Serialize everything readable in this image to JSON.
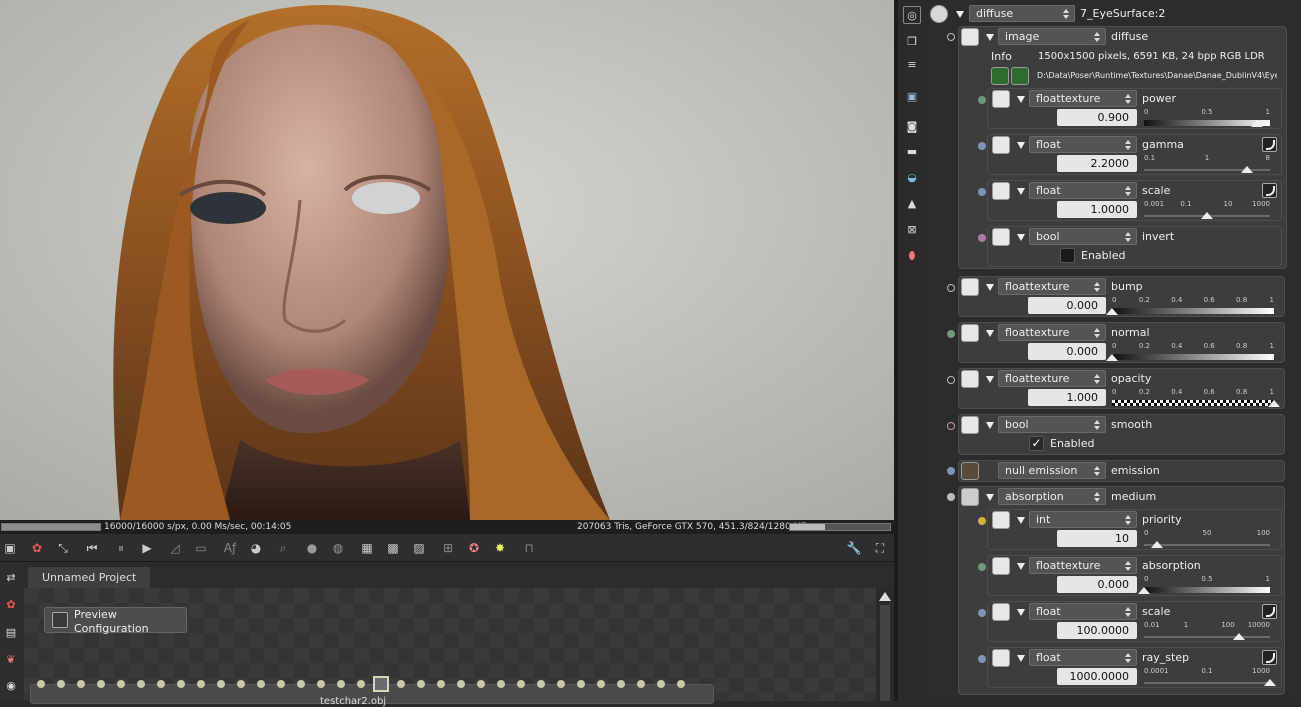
{
  "viewport": {
    "status_left": "16000/16000 s/px, 0.00 Ms/sec, 00:14:05",
    "status_right": "207063 Tris, GeForce GTX 570, 451.3/824/1280 MB",
    "progress": 1.0,
    "memory_fraction": 0.35
  },
  "graph": {
    "tab": "Unnamed Project",
    "preview_button": "Preview Configuration",
    "node_label": "testchar2.obj"
  },
  "panel": {
    "top": {
      "type": "diffuse",
      "name": "7_EyeSurface:2"
    },
    "image": {
      "type": "image",
      "name": "diffuse",
      "info_label": "Info",
      "info_value": "1500x1500 pixels, 6591 KB, 24 bpp RGB LDR",
      "path": "D:\\Data\\Poser\\Runtime\\Textures\\Danae\\Danae_DublinV4\\Eye_Blue_..."
    },
    "power": {
      "type": "floattexture",
      "name": "power",
      "value": "0.900",
      "ticks": [
        "0",
        "0.5",
        "1"
      ],
      "level": 0.9
    },
    "gamma": {
      "type": "float",
      "name": "gamma",
      "value": "2.2000",
      "ticks": [
        "0.1",
        "1",
        "8"
      ],
      "level": 0.82
    },
    "scale": {
      "type": "float",
      "name": "scale",
      "value": "1.0000",
      "ticks": [
        "0.001",
        "0.1",
        "10",
        "1000"
      ],
      "level": 0.5
    },
    "invert": {
      "type": "bool",
      "name": "invert",
      "check_label": "Enabled",
      "checked": false
    },
    "bump": {
      "type": "floattexture",
      "name": "bump",
      "value": "0.000",
      "ticks": [
        "0",
        "0.2",
        "0.4",
        "0.6",
        "0.8",
        "1"
      ],
      "level": 0.0
    },
    "normal": {
      "type": "floattexture",
      "name": "normal",
      "value": "0.000",
      "ticks": [
        "0",
        "0.2",
        "0.4",
        "0.6",
        "0.8",
        "1"
      ],
      "level": 0.0
    },
    "opacity": {
      "type": "floattexture",
      "name": "opacity",
      "value": "1.000",
      "ticks": [
        "0",
        "0.2",
        "0.4",
        "0.6",
        "0.8",
        "1"
      ],
      "level": 1.0
    },
    "smooth": {
      "type": "bool",
      "name": "smooth",
      "check_label": "Enabled",
      "checked": true
    },
    "emission": {
      "type": "null emission",
      "name": "emission"
    },
    "medium": {
      "type": "absorption",
      "name": "medium"
    },
    "priority": {
      "type": "int",
      "name": "priority",
      "value": "10",
      "ticks": [
        "0",
        "50",
        "100"
      ],
      "level": 0.1
    },
    "absorption": {
      "type": "floattexture",
      "name": "absorption",
      "value": "0.000",
      "ticks": [
        "0",
        "0.5",
        "1"
      ],
      "level": 0.0
    },
    "mscale": {
      "type": "float",
      "name": "scale",
      "value": "100.0000",
      "ticks": [
        "0.01",
        "1",
        "100",
        "10000"
      ],
      "level": 0.75
    },
    "ray_step": {
      "type": "float",
      "name": "ray_step",
      "value": "1000.0000",
      "ticks": [
        "0.0001",
        "0.1",
        "1000"
      ],
      "level": 1.0
    }
  },
  "colors": {
    "accent_socket_green": "#6f9a7a",
    "accent_socket_blue": "#7f93b8",
    "accent_socket_pink": "#b07aa8",
    "accent_socket_yellow": "#d4b13a"
  }
}
